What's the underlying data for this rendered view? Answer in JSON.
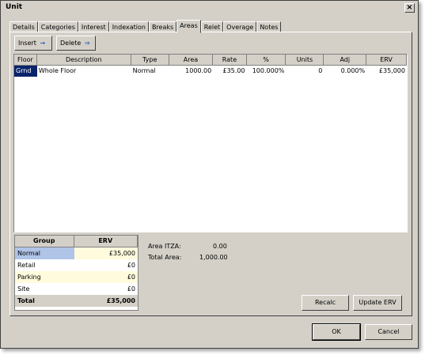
{
  "window": {
    "title": "Unit",
    "close_glyph": "×"
  },
  "tabs": [
    "Details",
    "Categories",
    "Interest",
    "Indexation",
    "Breaks",
    "Areas",
    "Relet",
    "Overage",
    "Notes"
  ],
  "active_tab": "Areas",
  "toolbar": {
    "insert_label": "Insert",
    "insert_icon": "→",
    "delete_label": "Delete",
    "delete_icon": "⇒"
  },
  "grid": {
    "columns": [
      "Floor",
      "Description",
      "Type",
      "Area",
      "Rate",
      "%",
      "Units",
      "Adj",
      "ERV"
    ],
    "rows": [
      {
        "floor": "Grnd",
        "description": "Whole Floor",
        "type": "Normal",
        "area": "1000.00",
        "rate": "£35.00",
        "pct": "100.000%",
        "units": "0",
        "adj": "0.000%",
        "erv": "£35,000"
      }
    ]
  },
  "summary": {
    "headers": [
      "Group",
      "ERV"
    ],
    "rows": [
      {
        "group": "Normal",
        "erv": "£35,000"
      },
      {
        "group": "Retail",
        "erv": "£0"
      },
      {
        "group": "Parking",
        "erv": "£0"
      },
      {
        "group": "Site",
        "erv": "£0"
      }
    ],
    "total": {
      "group": "Total",
      "erv": "£35,000"
    }
  },
  "info": {
    "itza_label": "Area ITZA:",
    "itza_value": "0.00",
    "total_label": "Total Area:",
    "total_value": "1,000.00"
  },
  "buttons": {
    "recalc": "Recalc",
    "update_erv": "Update ERV",
    "ok": "OK",
    "cancel": "Cancel"
  },
  "colors": {
    "selection": "#0a246a",
    "face": "#d4d0c8",
    "highlight": "#b0c4e8",
    "yellow_row": "#fffbdc"
  }
}
